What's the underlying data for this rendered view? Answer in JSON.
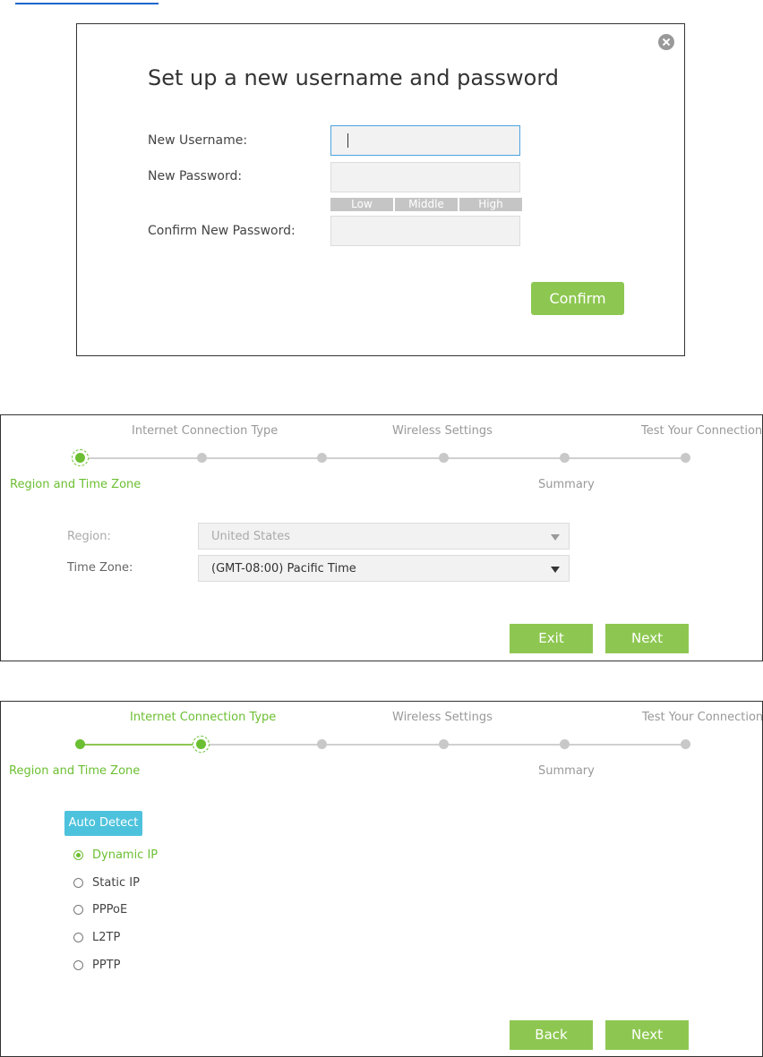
{
  "account_dialog": {
    "title": "Set up a new username and password",
    "username_label": "New Username:",
    "password_label": "New Password:",
    "confirm_password_label": "Confirm New Password:",
    "username_value": "",
    "password_value": "",
    "confirm_password_value": "",
    "strength": [
      "Low",
      "Middle",
      "High"
    ],
    "confirm_button": "Confirm"
  },
  "steps": {
    "internet": "Internet Connection Type",
    "wireless": "Wireless Settings",
    "test": "Test Your Connection",
    "region": "Region and Time Zone",
    "summary": "Summary"
  },
  "region_step": {
    "region_label": "Region:",
    "region_value": "United States",
    "timezone_label": "Time Zone:",
    "timezone_value": "(GMT-08:00) Pacific Time",
    "exit_button": "Exit",
    "next_button": "Next"
  },
  "connection_step": {
    "auto_detect_button": "Auto Detect",
    "options": [
      "Dynamic IP",
      "Static IP",
      "PPPoE",
      "L2TP",
      "PPTP"
    ],
    "selected": "Dynamic IP",
    "back_button": "Back",
    "next_button": "Next"
  },
  "colors": {
    "accent_green": "#8dc751",
    "active_green": "#6cbf32",
    "auto_detect_blue": "#4dc2dc"
  }
}
